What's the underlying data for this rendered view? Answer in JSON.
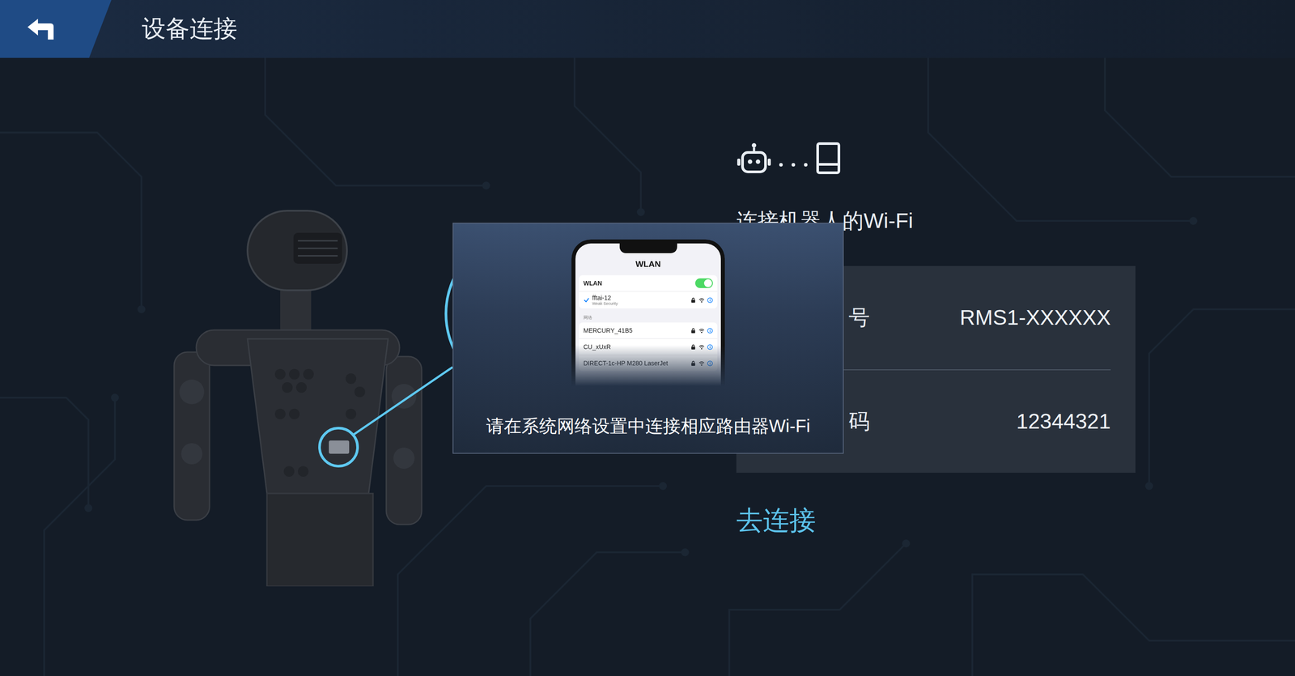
{
  "header": {
    "title": "设备连接"
  },
  "step": {
    "title": "连接机器人的Wi-Fi"
  },
  "credentials": [
    {
      "label": "号",
      "value": "RMS1-XXXXXX"
    },
    {
      "label": "码",
      "value": "12344321"
    }
  ],
  "connect_link": "去连接",
  "tooltip": {
    "caption": "请在系统网络设置中连接相应路由器Wi-Fi",
    "phone": {
      "title": "WLAN",
      "toggle_label": "WLAN",
      "toggle_on": true,
      "connected": {
        "name": "fftai-12",
        "subtitle": "Weak Security",
        "checked": true
      },
      "section_label": "网络",
      "networks": [
        {
          "name": "MERCURY_41B5"
        },
        {
          "name": "CU_xUxR"
        },
        {
          "name": "DIRECT-1c-HP M280 LaserJet"
        }
      ]
    }
  }
}
